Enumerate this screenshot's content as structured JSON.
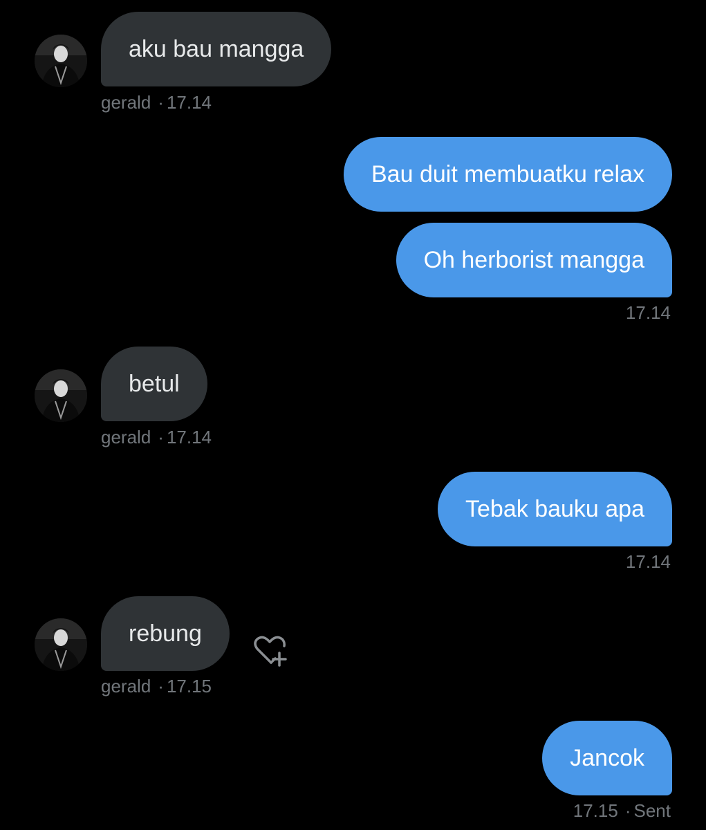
{
  "conversation": {
    "messages": [
      {
        "sender": "gerald",
        "direction": "in",
        "text": "aku bau mangga",
        "time": "17.14"
      },
      {
        "direction": "out",
        "text": "Bau duit membuatku relax"
      },
      {
        "direction": "out",
        "text": "Oh herborist mangga",
        "time": "17.14"
      },
      {
        "sender": "gerald",
        "direction": "in",
        "text": "betul",
        "time": "17.14"
      },
      {
        "direction": "out",
        "text": "Tebak bauku apa",
        "time": "17.14"
      },
      {
        "sender": "gerald",
        "direction": "in",
        "text": "rebung",
        "time": "17.15",
        "action_icon": "heart-plus-icon"
      },
      {
        "direction": "out",
        "text": "Jancok",
        "time": "17.15",
        "status": "Sent"
      }
    ],
    "separator": "·"
  },
  "colors": {
    "background": "#000000",
    "incoming_bubble": "#2f3336",
    "outgoing_bubble": "#4a98e9",
    "meta_text": "#71767b"
  }
}
